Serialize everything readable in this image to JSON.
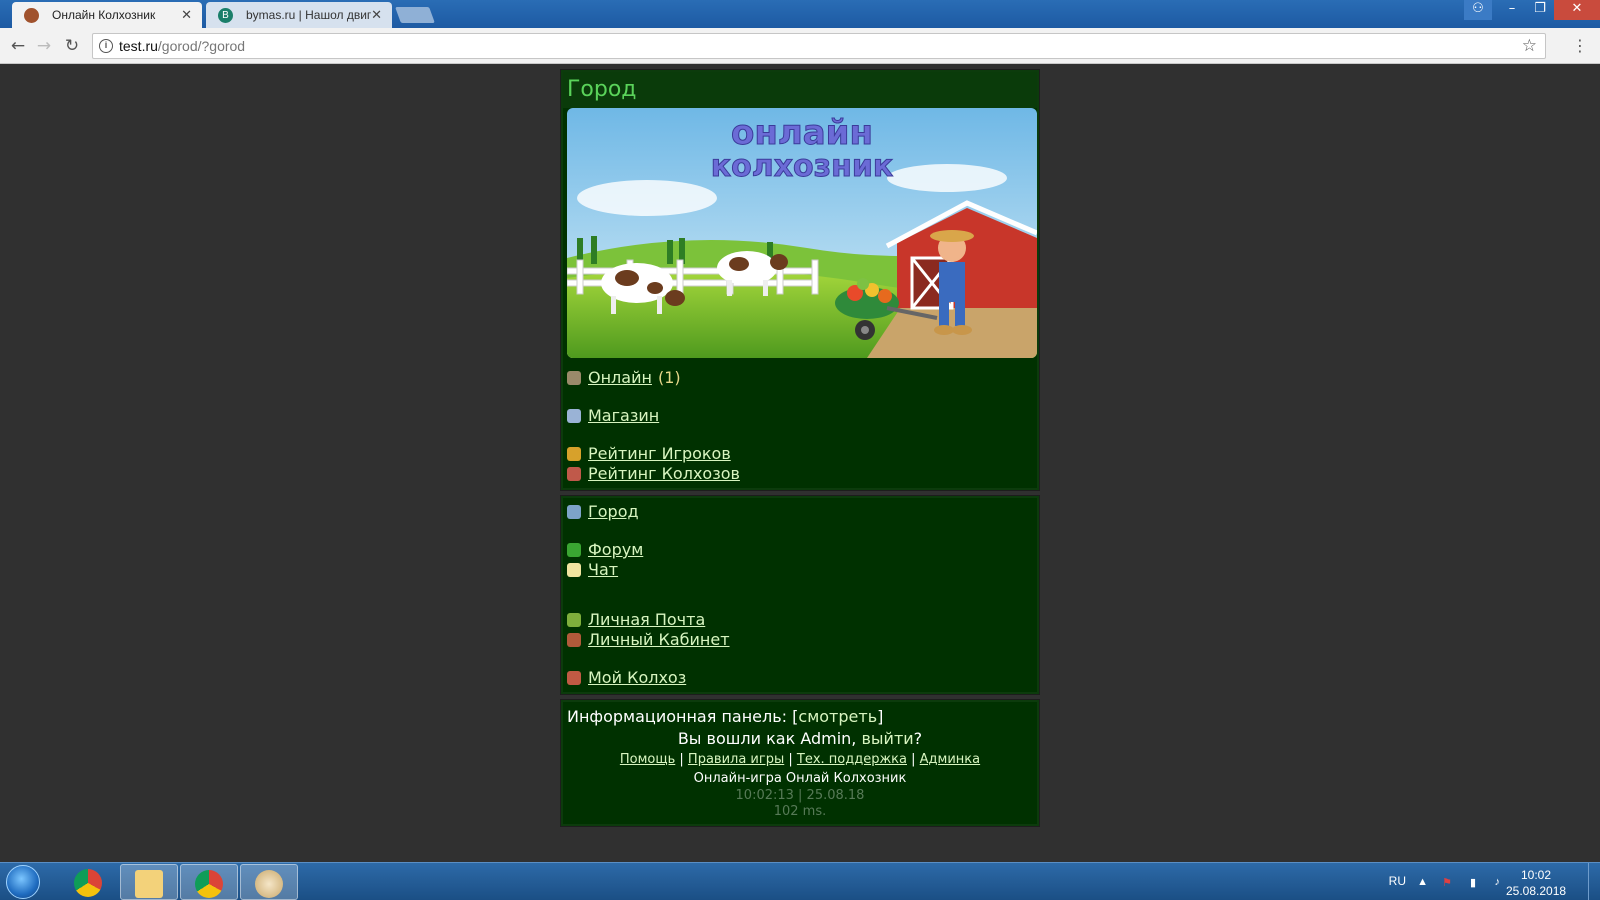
{
  "browser": {
    "tabs": [
      {
        "title": "Онлайн Колхозник",
        "active": true
      },
      {
        "title": "bymas.ru | Нашол двиг",
        "favicon_letter": "B",
        "active": false
      }
    ],
    "url_host": "test.ru",
    "url_path": "/gorod/?gorod"
  },
  "page": {
    "title": "Город",
    "banner": {
      "line1": "онлайн",
      "line2": "колхозник"
    },
    "menu_top": [
      {
        "label": "Онлайн",
        "count": "(1)",
        "icon": "globe-icon",
        "color": "#9a8a6a"
      },
      {
        "label": "Магазин",
        "icon": "shop-icon",
        "color": "#9ab3d6"
      },
      {
        "label": "Рейтинг Игроков",
        "icon": "trophy-icon",
        "color": "#d7a12b"
      },
      {
        "label": "Рейтинг Колхозов",
        "icon": "farm-icon",
        "color": "#c0594a"
      }
    ],
    "menu_bottom": [
      {
        "label": "Город",
        "icon": "city-icon",
        "color": "#7da3c8"
      },
      {
        "label": "Форум",
        "icon": "forum-icon",
        "color": "#3aa532"
      },
      {
        "label": "Чат",
        "icon": "chat-icon",
        "color": "#f2e5a0"
      },
      {
        "label": "Личная Почта",
        "icon": "mail-icon",
        "color": "#7fae3c"
      },
      {
        "label": "Личный Кабинет",
        "icon": "cabinet-icon",
        "color": "#b05a3a"
      },
      {
        "label": "Мой Колхоз",
        "icon": "home-icon",
        "color": "#c05a44"
      }
    ],
    "info": {
      "panel_label": "Информационная панель: [",
      "panel_link": "смотреть",
      "panel_end": "]",
      "logged_prefix": "Вы вошли как Admin, ",
      "logout": "выйти",
      "logged_suffix": "?"
    },
    "footer_links": [
      "Помощь",
      "Правила игры",
      "Тех. поддержка",
      "Админка"
    ],
    "game_name": "Онлайн-игра Онлай Колхозник",
    "datetime": "10:02:13 | 25.08.18",
    "render_time": "102 ms."
  },
  "taskbar": {
    "lang": "RU",
    "time": "10:02",
    "date": "25.08.2018"
  }
}
